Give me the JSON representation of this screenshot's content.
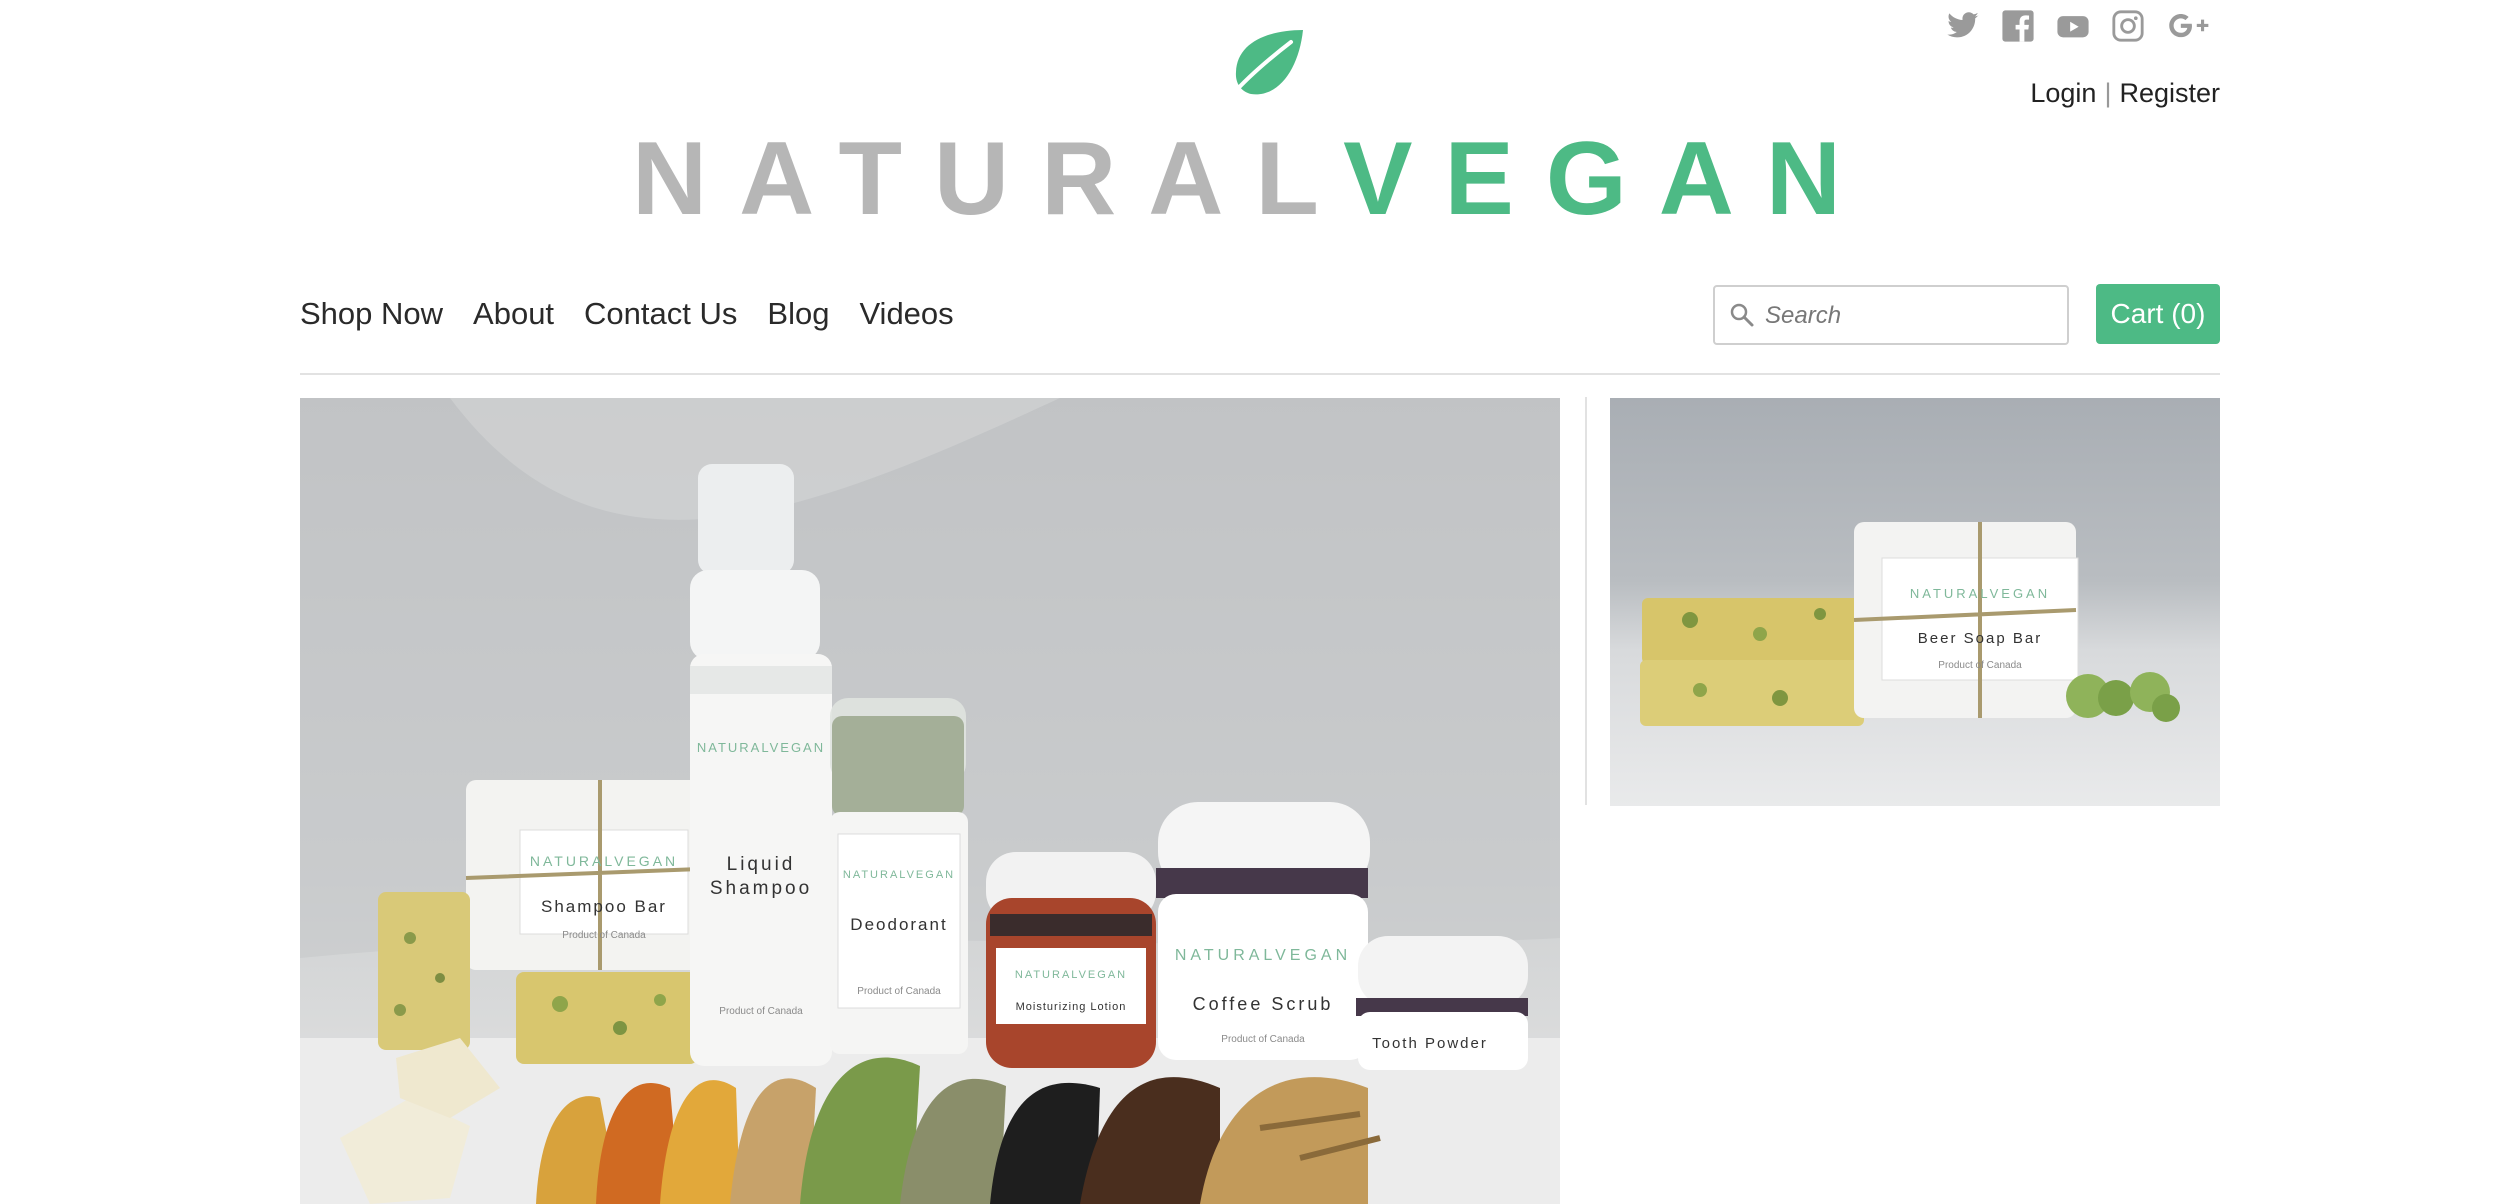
{
  "brand": {
    "logo_part1": "NATURAL",
    "logo_part2": "VEGAN",
    "logo_icon": "leaf-icon",
    "accent_color": "#4dba85",
    "gray_color": "#b6b6b6"
  },
  "social": [
    {
      "name": "twitter",
      "icon": "twitter-icon"
    },
    {
      "name": "facebook",
      "icon": "facebook-icon"
    },
    {
      "name": "youtube",
      "icon": "youtube-icon"
    },
    {
      "name": "instagram",
      "icon": "instagram-icon"
    },
    {
      "name": "google-plus",
      "icon": "google-plus-icon"
    }
  ],
  "account": {
    "login": "Login",
    "separator": "|",
    "register": "Register"
  },
  "nav": {
    "items": [
      "Shop Now",
      "About",
      "Contact Us",
      "Blog",
      "Videos"
    ]
  },
  "search": {
    "placeholder": "Search",
    "value": ""
  },
  "cart": {
    "label": "Cart (0)"
  },
  "hero": {
    "labels": {
      "brand": "NATURALVEGAN",
      "shampoo_bar": "Shampoo Bar",
      "liquid_shampoo_line1": "Liquid",
      "liquid_shampoo_line2": "Shampoo",
      "deodorant": "Deodorant",
      "moisturizing_lotion": "Moisturizing Lotion",
      "coffee_scrub": "Coffee Scrub",
      "tooth_powder": "Tooth Powder",
      "origin": "Product of Canada"
    }
  },
  "side": {
    "labels": {
      "brand": "NATURALVEGAN",
      "beer_soap_bar": "Beer Soap Bar",
      "origin": "Product of Canada"
    }
  }
}
